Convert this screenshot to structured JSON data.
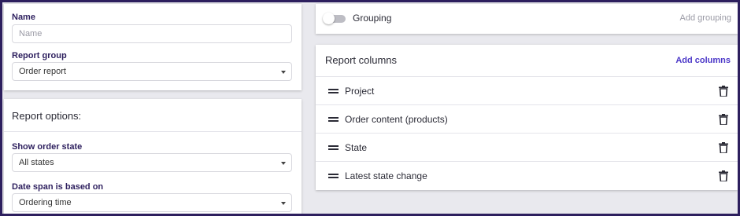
{
  "report_form": {
    "name_label": "Name",
    "name_placeholder": "Name",
    "name_value": "",
    "group_label": "Report group",
    "group_value": "Order report"
  },
  "report_options": {
    "title": "Report options:",
    "order_state_label": "Show order state",
    "order_state_value": "All states",
    "date_span_label": "Date span is based on",
    "date_span_value": "Ordering time"
  },
  "grouping": {
    "toggle_label": "Grouping",
    "toggle_on": false,
    "add_label": "Add grouping"
  },
  "report_columns": {
    "title": "Report columns",
    "add_label": "Add columns",
    "items": [
      {
        "label": "Project"
      },
      {
        "label": "Order content (products)"
      },
      {
        "label": "State"
      },
      {
        "label": "Latest state change"
      }
    ]
  },
  "colors": {
    "accent": "#4b37c8",
    "label": "#2d1f5e",
    "frame": "#2d1f5e",
    "background": "#e9e9ee"
  }
}
